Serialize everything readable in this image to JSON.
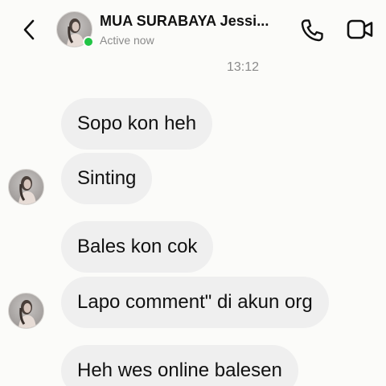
{
  "header": {
    "contact_name": "MUA SURABAYA Jessi...",
    "status": "Active now"
  },
  "timestamp": "13:12",
  "messages": [
    {
      "text": "Sopo kon heh",
      "show_avatar": false
    },
    {
      "text": "Sinting",
      "show_avatar": true
    },
    {
      "text": "Bales kon cok",
      "show_avatar": false
    },
    {
      "text": "Lapo comment\" di akun org",
      "show_avatar": true
    },
    {
      "text": "Heh wes online balesen",
      "show_avatar": false
    }
  ],
  "colors": {
    "background": "#fbfbf9",
    "bubble": "#efefef",
    "online": "#21c445"
  }
}
